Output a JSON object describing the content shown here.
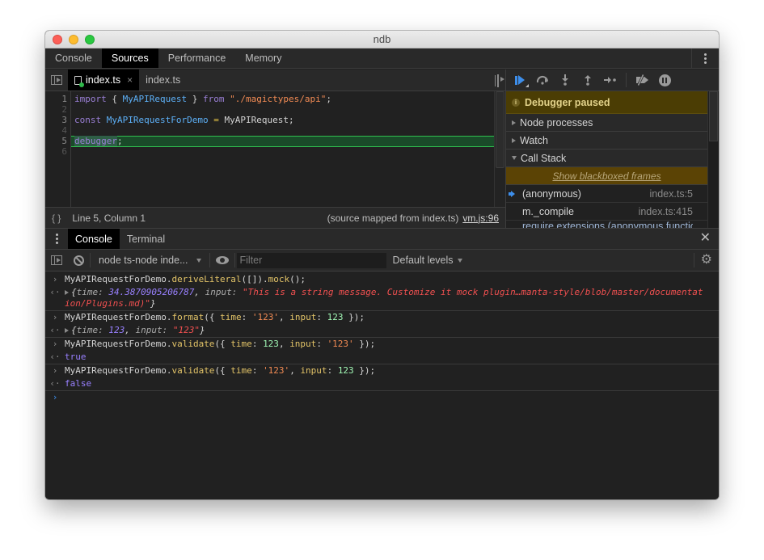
{
  "window": {
    "title": "ndb"
  },
  "main_tabs": [
    {
      "label": "Console",
      "active": false
    },
    {
      "label": "Sources",
      "active": true
    },
    {
      "label": "Performance",
      "active": false
    },
    {
      "label": "Memory",
      "active": false
    }
  ],
  "editor": {
    "file_tabs": [
      {
        "label": "index.ts",
        "active": true,
        "closable": true
      },
      {
        "label": "index.ts",
        "active": false,
        "closable": false
      }
    ],
    "line_numbers": [
      "1",
      "2",
      "3",
      "4",
      "5",
      "6"
    ],
    "code": {
      "line1": {
        "kw1": "import",
        "brace_open": " { ",
        "ident": "MyAPIRequest",
        "brace_close": " } ",
        "kw2": "from",
        "space": " ",
        "str": "\"./magictypes/api\"",
        "semi": ";"
      },
      "line3": {
        "kw": "const",
        "space": " ",
        "ident": "MyAPIRequestForDemo",
        "eq": " = ",
        "rhs": "MyAPIRequest;"
      },
      "line5": {
        "kw": "debugger",
        "semi": ";"
      }
    },
    "execution_line": 5,
    "status": {
      "braces_icon": "{ }",
      "cursor": "Line 5, Column 1",
      "source_mapped": "(source mapped from index.ts)",
      "source_link": "vm.js:96"
    }
  },
  "debugger": {
    "toolbar_icons": [
      "resume-icon",
      "step-over-icon",
      "step-into-icon",
      "step-out-icon",
      "step-icon",
      "deactivate-breakpoints-icon",
      "pause-on-exceptions-icon"
    ],
    "paused_banner": "Debugger paused",
    "sections": [
      {
        "label": "Node processes",
        "expanded": false
      },
      {
        "label": "Watch",
        "expanded": false
      },
      {
        "label": "Call Stack",
        "expanded": true
      }
    ],
    "blackboxed_link": "Show blackboxed frames",
    "call_stack": [
      {
        "name": "(anonymous)",
        "location": "index.ts:5",
        "current": true
      },
      {
        "name": "m._compile",
        "location": "index.ts:415",
        "current": false
      },
      {
        "name": "require.extensions.(anonymous function)",
        "location": "",
        "current": false
      }
    ]
  },
  "drawer": {
    "tabs": [
      {
        "label": "Console",
        "active": true
      },
      {
        "label": "Terminal",
        "active": false
      }
    ],
    "context_select": "node ts-node inde...",
    "filter_placeholder": "Filter",
    "filter_value": "",
    "levels_label": "Default levels"
  },
  "console": {
    "entries": [
      {
        "input": {
          "obj": "MyAPIRequestForDemo.",
          "fn": "deriveLiteral",
          "args": "([]).",
          "fn2": "mock",
          "end": "();"
        },
        "output": {
          "open": "{",
          "k1": "time: ",
          "v1": "34.3870905206787",
          "sep": ", ",
          "k2": "input: ",
          "v2": "\"This is a string message. Customize it mock plugin…manta-style/blob/master/documentation/Plugins.md)\"",
          "close": "}"
        }
      },
      {
        "input": {
          "obj": "MyAPIRequestForDemo.",
          "fn": "format",
          "open": "({ ",
          "k1": "time",
          "colon1": ": ",
          "v1": "'123'",
          "sep": ", ",
          "k2": "input",
          "colon2": ": ",
          "v2": "123",
          "close": " });"
        },
        "output": {
          "open": "{",
          "k1": "time: ",
          "v1": "123",
          "sep": ", ",
          "k2": "input: ",
          "v2": "\"123\"",
          "close": "}"
        }
      },
      {
        "input": {
          "obj": "MyAPIRequestForDemo.",
          "fn": "validate",
          "open": "({ ",
          "k1": "time",
          "colon1": ": ",
          "v1": "123",
          "sep": ", ",
          "k2": "input",
          "colon2": ": ",
          "v2": "'123'",
          "close": " });"
        },
        "output": "true"
      },
      {
        "input": {
          "obj": "MyAPIRequestForDemo.",
          "fn": "validate",
          "open": "({ ",
          "k1": "time",
          "colon1": ": ",
          "v1": "'123'",
          "sep": ", ",
          "k2": "input",
          "colon2": ": ",
          "v2": "123",
          "close": " });"
        },
        "output": "false"
      }
    ],
    "input_prompt": "›",
    "input_arrow": "›",
    "output_arrow": "‹·"
  },
  "colors": {
    "accent_blue": "#3d8eeb",
    "paused_banner_bg": "#4b3d04",
    "execution_line_bg": "#1a4a29",
    "string_red": "#f05050",
    "number_purple": "#9980ff"
  }
}
